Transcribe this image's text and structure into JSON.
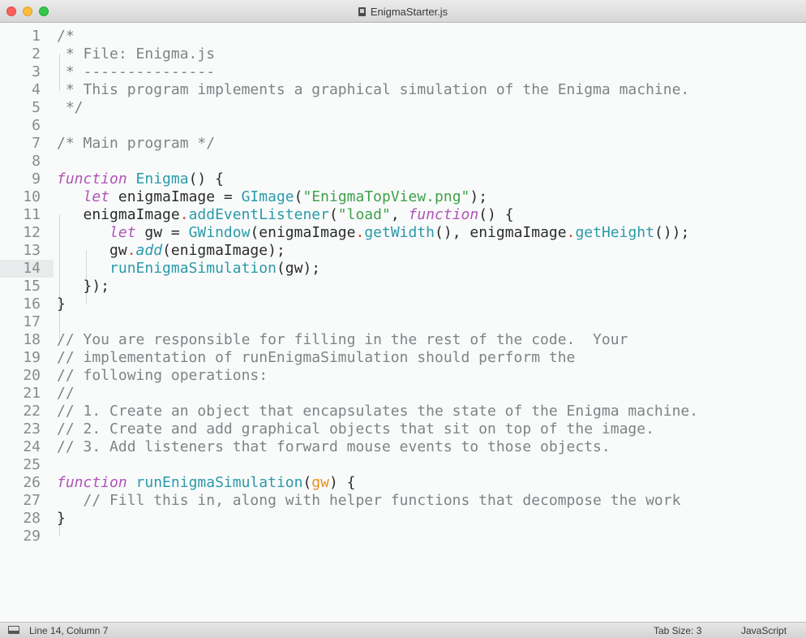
{
  "window": {
    "title": "EnigmaStarter.js"
  },
  "editor": {
    "current_line": 14,
    "lines": [
      [
        [
          "/*",
          "comment"
        ]
      ],
      [
        [
          " * File: Enigma.js",
          "comment"
        ]
      ],
      [
        [
          " * ---------------",
          "comment"
        ]
      ],
      [
        [
          " * This program implements a graphical simulation of the Enigma machine.",
          "comment"
        ]
      ],
      [
        [
          " */",
          "comment"
        ]
      ],
      [],
      [
        [
          "/* Main program */",
          "comment"
        ]
      ],
      [],
      [
        [
          "function",
          "kw"
        ],
        [
          " ",
          "plain"
        ],
        [
          "Enigma",
          "fn"
        ],
        [
          "() {",
          "plain"
        ]
      ],
      [
        [
          "   ",
          "plain"
        ],
        [
          "let",
          "kw"
        ],
        [
          " enigmaImage = ",
          "plain"
        ],
        [
          "GImage",
          "fn"
        ],
        [
          "(",
          "plain"
        ],
        [
          "\"EnigmaTopView.png\"",
          "str"
        ],
        [
          ");",
          "plain"
        ]
      ],
      [
        [
          "   enigmaImage",
          "plain"
        ],
        [
          ".",
          "dot"
        ],
        [
          "addEventListener",
          "fn"
        ],
        [
          "(",
          "plain"
        ],
        [
          "\"load\"",
          "str"
        ],
        [
          ", ",
          "plain"
        ],
        [
          "function",
          "kw"
        ],
        [
          "() {",
          "plain"
        ]
      ],
      [
        [
          "      ",
          "plain"
        ],
        [
          "let",
          "kw"
        ],
        [
          " gw = ",
          "plain"
        ],
        [
          "GWindow",
          "fn"
        ],
        [
          "(enigmaImage",
          "plain"
        ],
        [
          ".",
          "dot"
        ],
        [
          "getWidth",
          "fn"
        ],
        [
          "(), enigmaImage",
          "plain"
        ],
        [
          ".",
          "dot"
        ],
        [
          "getHeight",
          "fn"
        ],
        [
          "());",
          "plain"
        ]
      ],
      [
        [
          "      gw",
          "plain"
        ],
        [
          ".",
          "dot"
        ],
        [
          "add",
          "add"
        ],
        [
          "(enigmaImage);",
          "plain"
        ]
      ],
      [
        [
          "      ",
          "plain"
        ],
        [
          "runEnigmaSimulation",
          "fn"
        ],
        [
          "(gw);",
          "plain"
        ]
      ],
      [
        [
          "   });",
          "plain"
        ]
      ],
      [
        [
          "}",
          "plain"
        ]
      ],
      [],
      [
        [
          "// You are responsible for filling in the rest of the code.  Your",
          "comment"
        ]
      ],
      [
        [
          "// implementation of runEnigmaSimulation should perform the",
          "comment"
        ]
      ],
      [
        [
          "// following operations:",
          "comment"
        ]
      ],
      [
        [
          "//",
          "comment"
        ]
      ],
      [
        [
          "// 1. Create an object that encapsulates the state of the Enigma machine.",
          "comment"
        ]
      ],
      [
        [
          "// 2. Create and add graphical objects that sit on top of the image.",
          "comment"
        ]
      ],
      [
        [
          "// 3. Add listeners that forward mouse events to those objects.",
          "comment"
        ]
      ],
      [],
      [
        [
          "function",
          "kw"
        ],
        [
          " ",
          "plain"
        ],
        [
          "runEnigmaSimulation",
          "fn"
        ],
        [
          "(",
          "plain"
        ],
        [
          "gw",
          "param"
        ],
        [
          ") {",
          "plain"
        ]
      ],
      [
        [
          "   ",
          "plain"
        ],
        [
          "// Fill this in, along with helper functions that decompose the work",
          "comment"
        ]
      ],
      [
        [
          "}",
          "plain"
        ]
      ],
      []
    ]
  },
  "statusbar": {
    "position": "Line 14, Column 7",
    "tab_size": "Tab Size: 3",
    "language": "JavaScript"
  }
}
